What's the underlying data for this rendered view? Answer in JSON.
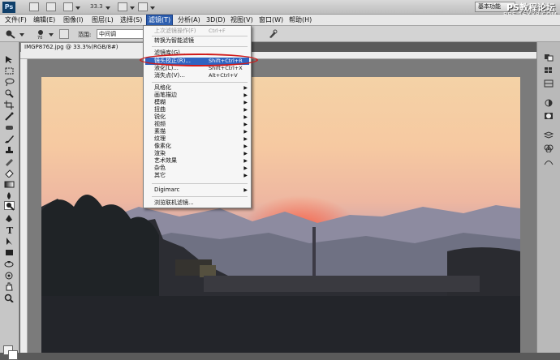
{
  "appbar": {
    "logo": "Ps",
    "zoom_value": "33.3",
    "workspace_label": "基本功能",
    "watermark": "PS教程论坛",
    "watermark_url": "BBS.16XX8.COM"
  },
  "menubar": {
    "items": [
      {
        "label": "文件(F)"
      },
      {
        "label": "编辑(E)"
      },
      {
        "label": "图像(I)"
      },
      {
        "label": "图层(L)"
      },
      {
        "label": "选择(S)"
      },
      {
        "label": "滤镜(T)"
      },
      {
        "label": "分析(A)"
      },
      {
        "label": "3D(D)"
      },
      {
        "label": "视图(V)"
      },
      {
        "label": "窗口(W)"
      },
      {
        "label": "帮助(H)"
      }
    ],
    "active_index": 5
  },
  "options": {
    "range_label": "范围:",
    "range_value": "中间调",
    "brush_size": "70"
  },
  "document": {
    "tab_title": "IMGP8762.jpg @ 33.3%(RGB/8#)",
    "close_glyph": "×"
  },
  "filter_menu": {
    "items": [
      {
        "label": "上次滤镜操作(F)",
        "shortcut": "Ctrl+F",
        "disabled": true
      },
      {
        "separator": true
      },
      {
        "label": "转换为智能滤镜"
      },
      {
        "separator": true
      },
      {
        "label": "滤镜库(G)..."
      },
      {
        "label": "镜头校正(R)...",
        "shortcut": "Shift+Ctrl+R",
        "highlighted": true
      },
      {
        "label": "液化(L)...",
        "shortcut": "Shift+Ctrl+X"
      },
      {
        "label": "消失点(V)...",
        "shortcut": "Alt+Ctrl+V"
      },
      {
        "separator": true
      },
      {
        "label": "风格化",
        "submenu": true
      },
      {
        "label": "画笔描边",
        "submenu": true
      },
      {
        "label": "模糊",
        "submenu": true
      },
      {
        "label": "扭曲",
        "submenu": true
      },
      {
        "label": "锐化",
        "submenu": true
      },
      {
        "label": "视频",
        "submenu": true
      },
      {
        "label": "素描",
        "submenu": true
      },
      {
        "label": "纹理",
        "submenu": true
      },
      {
        "label": "像素化",
        "submenu": true
      },
      {
        "label": "渲染",
        "submenu": true
      },
      {
        "label": "艺术效果",
        "submenu": true
      },
      {
        "label": "杂色",
        "submenu": true
      },
      {
        "label": "其它",
        "submenu": true
      },
      {
        "separator": true
      },
      {
        "label": "Digimarc",
        "submenu": true
      },
      {
        "separator": true
      },
      {
        "label": "浏览联机滤镜..."
      }
    ]
  },
  "colors": {
    "menu_highlight": "#2f63c1",
    "annotation": "#d01a1a"
  }
}
